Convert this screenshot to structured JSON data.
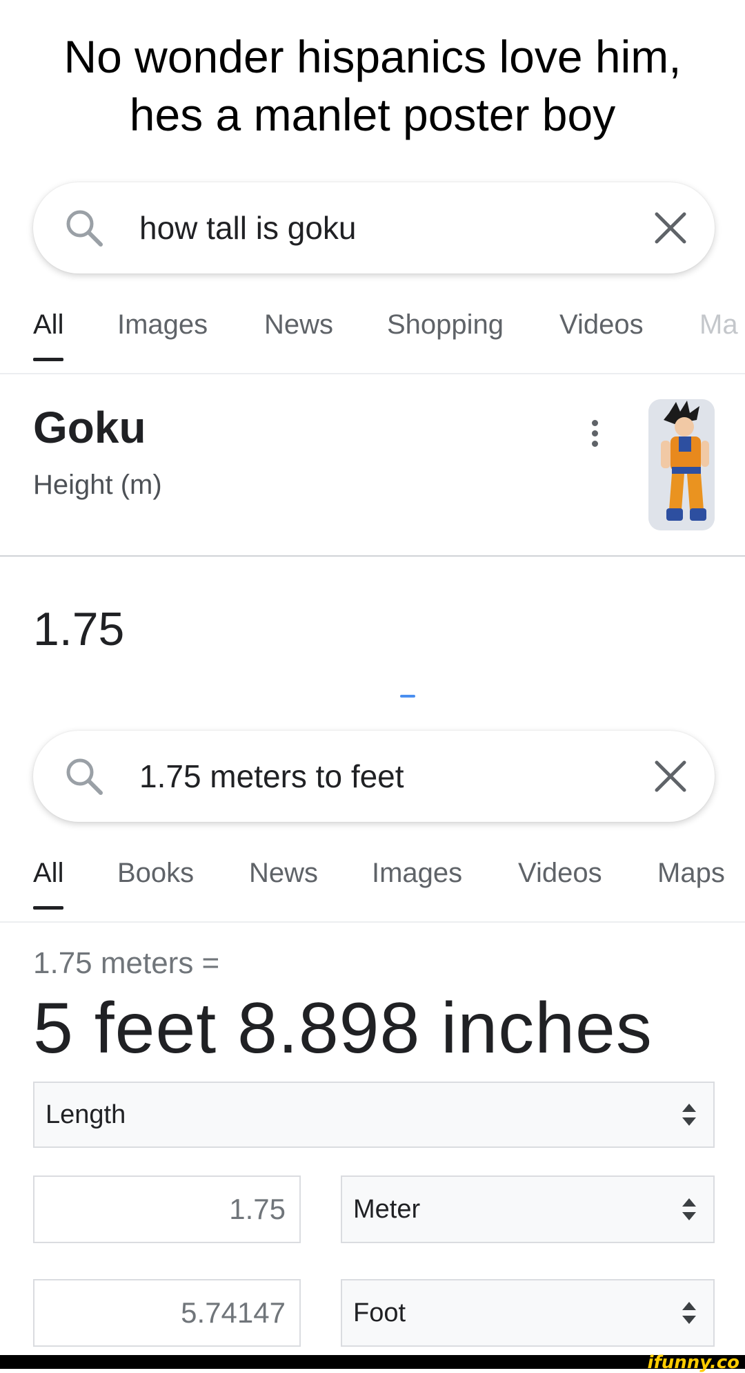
{
  "caption": {
    "line1": "No wonder hispanics love him,",
    "line2": "hes a manlet poster boy"
  },
  "search1": {
    "query": "how tall is goku",
    "icon": "search-icon",
    "clear_icon": "close-icon"
  },
  "tabs1": [
    "All",
    "Images",
    "News",
    "Shopping",
    "Videos",
    "Ma"
  ],
  "knowledge": {
    "name": "Goku",
    "attribute": "Height (m)",
    "value": "1.75",
    "thumbnail": "goku-thumbnail-image"
  },
  "search2": {
    "query": "1.75 meters to feet",
    "icon": "search-icon",
    "clear_icon": "close-icon"
  },
  "tabs2": [
    "All",
    "Books",
    "News",
    "Images",
    "Videos",
    "Maps"
  ],
  "converter": {
    "lead": "1.75 meters =",
    "result": "5 feet 8.898 inches",
    "category": "Length",
    "from_value": "1.75",
    "from_unit": "Meter",
    "to_value": "5.74147",
    "to_unit": "Foot"
  },
  "watermark": "ifunny.co",
  "colors": {
    "text": "#202124",
    "secondary": "#5f6368",
    "link_blue": "#4a8ff0",
    "watermark": "#ffcc00"
  }
}
